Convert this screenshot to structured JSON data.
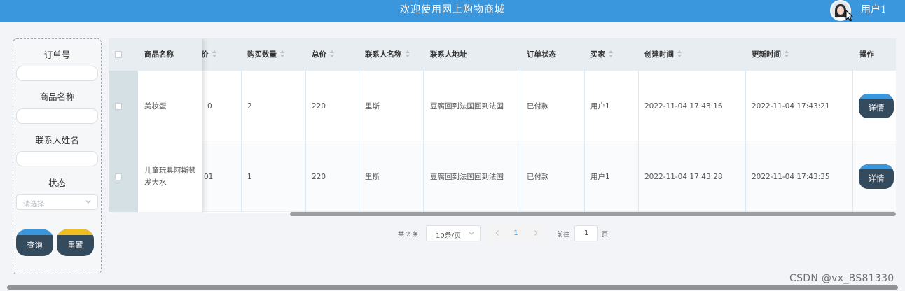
{
  "header": {
    "title": "欢迎使用网上购物商城",
    "username": "用户1"
  },
  "search": {
    "order_no_label": "订单号",
    "product_name_label": "商品名称",
    "contact_name_label": "联系人姓名",
    "status_label": "状态",
    "status_placeholder": "请选择",
    "query_button": "查询",
    "reset_button": "重置"
  },
  "table": {
    "columns": [
      "商品名称",
      "价",
      "购买数量",
      "总价",
      "联系人名称",
      "联系人地址",
      "订单状态",
      "买家",
      "创建时间",
      "更新时间",
      "操作"
    ],
    "rows": [
      {
        "product": "美妆蛋",
        "price": "0",
        "quantity": "2",
        "total": "220",
        "contact": "里斯",
        "address": "豆腐回到法国回到法国",
        "status": "已付款",
        "buyer": "用户1",
        "created": "2022-11-04 17:43:16",
        "updated": "2022-11-04 17:43:21",
        "action": "详情"
      },
      {
        "product_line1": "儿童玩具阿斯顿",
        "product_line2": "发大水",
        "price": "01",
        "quantity": "1",
        "total": "220",
        "contact": "里斯",
        "address": "豆腐回到法国回到法国",
        "status": "已付款",
        "buyer": "用户1",
        "created": "2022-11-04 17:43:28",
        "updated": "2022-11-04 17:43:35",
        "action": "详情"
      }
    ]
  },
  "pagination": {
    "total_text": "共 2 条",
    "page_size": "10条/页",
    "current_page": "1",
    "goto_prefix": "前往",
    "goto_value": "1",
    "goto_suffix": "页"
  },
  "watermark": "CSDN @vx_BS81330",
  "colors": {
    "header": "#3a97de",
    "button_dark": "#344a5d",
    "accent_blue": "#3a97de",
    "accent_yellow": "#f0be1e"
  },
  "icons": [
    "avatar",
    "cursor-pointer-icon",
    "chevron-down-icon",
    "sort-icon",
    "chevron-left-icon",
    "chevron-right-icon"
  ]
}
